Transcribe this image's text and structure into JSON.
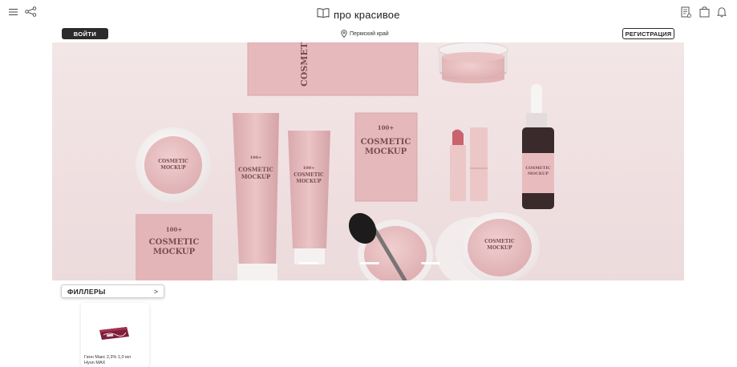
{
  "header": {
    "menu_icon": "hamburger-menu-icon",
    "share_icon": "share-icon",
    "logo_text": "про красивое",
    "logo_icon": "open-book-icon",
    "right_icons": [
      "catalog-list-icon",
      "shopping-bag-icon",
      "bell-icon"
    ]
  },
  "subheader": {
    "login_label": "ВОЙТИ",
    "region_icon": "location-pin-icon",
    "region_label": "Пермский край",
    "register_label": "РЕГИСТРАЦИЯ"
  },
  "hero": {
    "slides_count": 3,
    "active_slide": 1
  },
  "category": {
    "label": "ФИЛЛЕРЫ",
    "chevron": ">"
  },
  "products": [
    {
      "name_line1": "Гион Макс 2,3% 1,0 мл",
      "name_line2": "Hyon MAX"
    }
  ],
  "colors": {
    "accent_dark": "#2b2b2b",
    "hero_bg": "#efdfe0",
    "product_pink": "#e8bcbe"
  }
}
